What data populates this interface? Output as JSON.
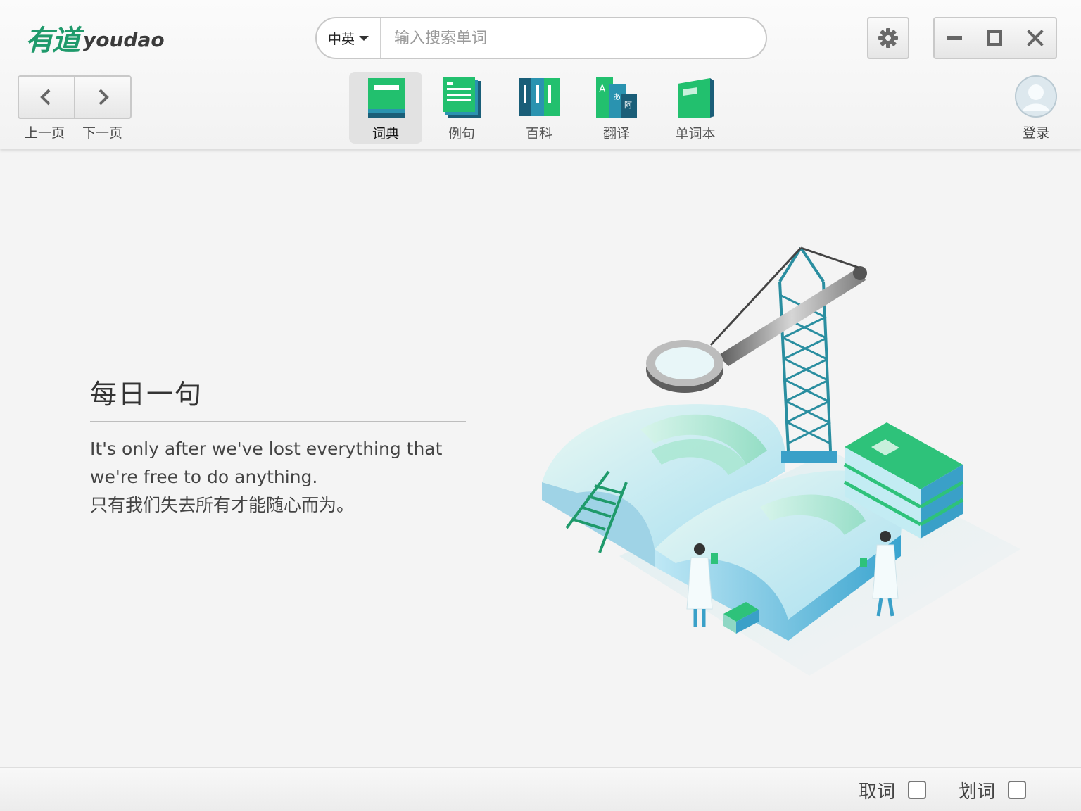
{
  "app": {
    "logo_cn": "有道",
    "logo_en": "youdao"
  },
  "search": {
    "lang_label": "中英",
    "placeholder": "输入搜索单词",
    "value": ""
  },
  "window_controls": {
    "icons": [
      "gear-icon",
      "minimize-icon",
      "maximize-icon",
      "close-icon"
    ]
  },
  "nav": {
    "prev_label": "上一页",
    "next_label": "下一页"
  },
  "tabs": [
    {
      "label": "词典",
      "icon": "dictionary-icon",
      "active": true
    },
    {
      "label": "例句",
      "icon": "sentences-icon",
      "active": false
    },
    {
      "label": "百科",
      "icon": "encyclopedia-icon",
      "active": false
    },
    {
      "label": "翻译",
      "icon": "translate-icon",
      "active": false
    },
    {
      "label": "单词本",
      "icon": "wordbook-icon",
      "active": false
    }
  ],
  "user": {
    "login_label": "登录"
  },
  "daily": {
    "title": "每日一句",
    "sentence_en_1": "It's only after we've lost everything that",
    "sentence_en_2": "we're free to do anything.",
    "sentence_cn": "只有我们失去所有才能随心而为。"
  },
  "footer": {
    "capture_label": "取词",
    "capture_checked": false,
    "select_label": "划词",
    "select_checked": false
  },
  "colors": {
    "brand_green": "#1f9a6b",
    "teal": "#2a8ea0",
    "active_tab_bg": "#e2e2e2"
  }
}
